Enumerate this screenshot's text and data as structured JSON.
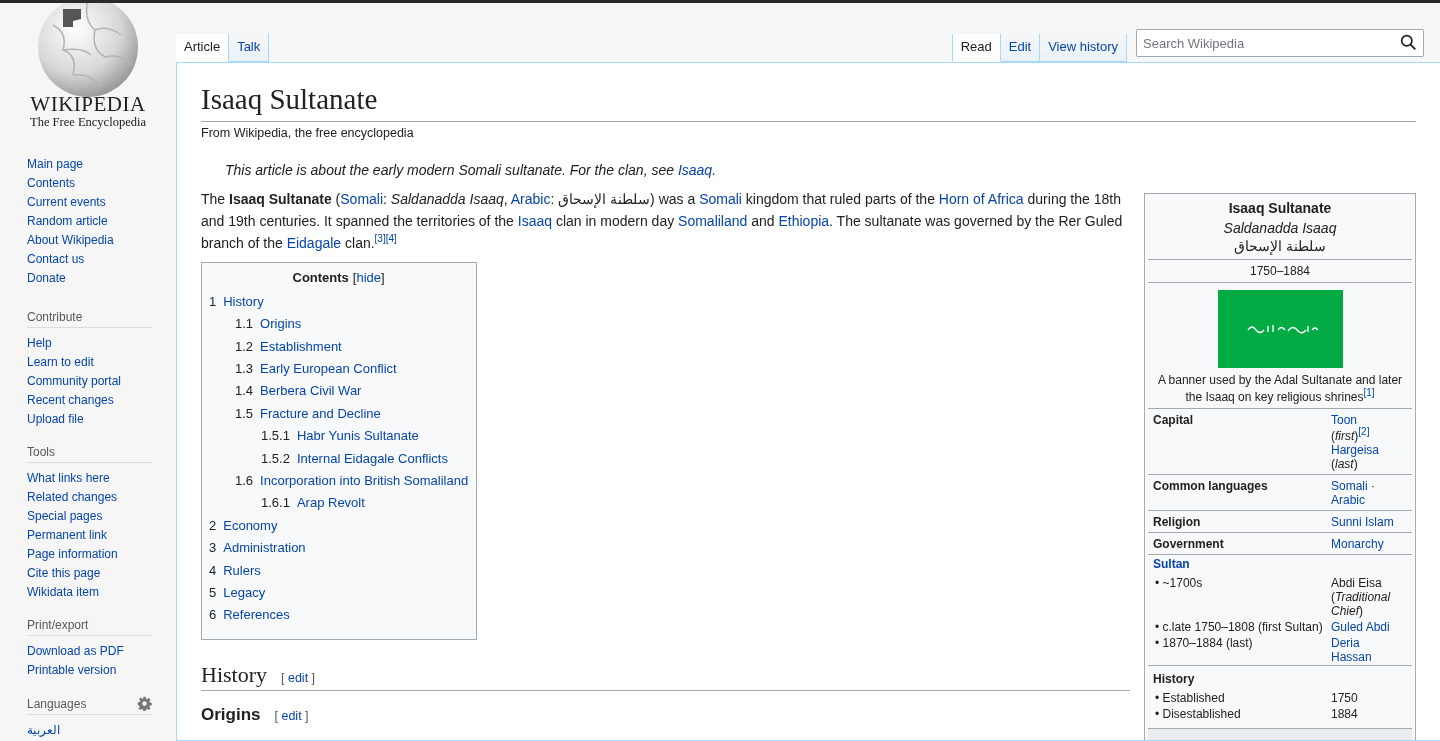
{
  "logo": {
    "wordmark": "WIKIPEDIA",
    "tagline": "The Free Encyclopedia"
  },
  "sidebar": {
    "navigation": [
      "Main page",
      "Contents",
      "Current events",
      "Random article",
      "About Wikipedia",
      "Contact us",
      "Donate"
    ],
    "sections": [
      {
        "title": "Contribute",
        "items": [
          "Help",
          "Learn to edit",
          "Community portal",
          "Recent changes",
          "Upload file"
        ]
      },
      {
        "title": "Tools",
        "items": [
          "What links here",
          "Related changes",
          "Special pages",
          "Permanent link",
          "Page information",
          "Cite this page",
          "Wikidata item"
        ]
      },
      {
        "title": "Print/export",
        "items": [
          "Download as PDF",
          "Printable version"
        ]
      },
      {
        "title": "Languages",
        "settings": true,
        "items": [
          "العربية"
        ]
      }
    ]
  },
  "namespace_tabs": [
    {
      "label": "Article",
      "selected": true
    },
    {
      "label": "Talk",
      "selected": false
    }
  ],
  "view_tabs": [
    {
      "label": "Read",
      "selected": true
    },
    {
      "label": "Edit",
      "selected": false
    },
    {
      "label": "View history",
      "selected": false
    }
  ],
  "search": {
    "placeholder": "Search Wikipedia"
  },
  "article": {
    "title": "Isaaq Sultanate",
    "tagline": "From Wikipedia, the free encyclopedia",
    "hatnote": {
      "text": "This article is about the early modern Somali sultanate. For the clan, see ",
      "link": "Isaaq",
      "end": "."
    },
    "lead": [
      {
        "kind": "text",
        "text": "The "
      },
      {
        "kind": "bold",
        "text": "Isaaq Sultanate"
      },
      {
        "kind": "text",
        "text": " ("
      },
      {
        "kind": "link",
        "text": "Somali"
      },
      {
        "kind": "text",
        "text": ": "
      },
      {
        "kind": "italic",
        "text": "Saldanadda Isaaq"
      },
      {
        "kind": "text",
        "text": ", "
      },
      {
        "kind": "link",
        "text": "Arabic"
      },
      {
        "kind": "text",
        "text": ": سلطنة الإسحاق) was a "
      },
      {
        "kind": "link",
        "text": "Somali"
      },
      {
        "kind": "text",
        "text": " kingdom that ruled parts of the "
      },
      {
        "kind": "link",
        "text": "Horn of Africa"
      },
      {
        "kind": "text",
        "text": " during the 18th and 19th centuries. It spanned the territories of the "
      },
      {
        "kind": "link",
        "text": "Isaaq"
      },
      {
        "kind": "text",
        "text": " clan in modern day "
      },
      {
        "kind": "link",
        "text": "Somaliland"
      },
      {
        "kind": "text",
        "text": " and "
      },
      {
        "kind": "link",
        "text": "Ethiopia"
      },
      {
        "kind": "text",
        "text": ". The sultanate was governed by the Rer Guled branch of the "
      },
      {
        "kind": "link",
        "text": "Eidagale"
      },
      {
        "kind": "text",
        "text": " clan."
      },
      {
        "kind": "ref",
        "text": "[3]"
      },
      {
        "kind": "ref",
        "text": "[4]"
      }
    ],
    "toc": {
      "title": "Contents",
      "toggle_open": "[",
      "toggle": "hide",
      "toggle_close": "]",
      "items": [
        {
          "number": "1",
          "text": "History",
          "children": [
            {
              "number": "1.1",
              "text": "Origins"
            },
            {
              "number": "1.2",
              "text": "Establishment"
            },
            {
              "number": "1.3",
              "text": "Early European Conflict"
            },
            {
              "number": "1.4",
              "text": "Berbera Civil War"
            },
            {
              "number": "1.5",
              "text": "Fracture and Decline",
              "children": [
                {
                  "number": "1.5.1",
                  "text": "Habr Yunis Sultanate"
                },
                {
                  "number": "1.5.2",
                  "text": "Internal Eidagale Conflicts"
                }
              ]
            },
            {
              "number": "1.6",
              "text": "Incorporation into British Somaliland",
              "children": [
                {
                  "number": "1.6.1",
                  "text": "Arap Revolt"
                }
              ]
            }
          ]
        },
        {
          "number": "2",
          "text": "Economy"
        },
        {
          "number": "3",
          "text": "Administration"
        },
        {
          "number": "4",
          "text": "Rulers"
        },
        {
          "number": "5",
          "text": "Legacy"
        },
        {
          "number": "6",
          "text": "References"
        }
      ]
    },
    "sections": [
      {
        "kind": "h2",
        "title": "History",
        "edit_open": "[",
        "edit": "edit",
        "edit_close": "]"
      },
      {
        "kind": "h3",
        "title": "Origins",
        "edit_open": "[",
        "edit": "edit",
        "edit_close": "]"
      }
    ]
  },
  "infobox": {
    "title": "Isaaq Sultanate",
    "native_name": "Saldanadda Isaaq",
    "arabic_name": "سلطنة الإسحاق",
    "dates": "1750–1884",
    "caption": [
      {
        "kind": "text",
        "text": "A banner used by the Adal Sultanate and later the Isaaq on key religious shrines"
      },
      {
        "kind": "ref",
        "text": "[1]"
      }
    ],
    "rows": [
      {
        "kind": "row",
        "label": "Capital",
        "lines": [
          [
            {
              "kind": "link",
              "text": "Toon"
            }
          ],
          [
            {
              "kind": "text",
              "text": "("
            },
            {
              "kind": "italic",
              "text": "first"
            },
            {
              "kind": "text",
              "text": ")"
            },
            {
              "kind": "ref",
              "text": "[2]"
            }
          ],
          [
            {
              "kind": "link",
              "text": "Hargeisa"
            }
          ],
          [
            {
              "kind": "text",
              "text": "("
            },
            {
              "kind": "italic",
              "text": "last"
            },
            {
              "kind": "text",
              "text": ")"
            }
          ]
        ]
      },
      {
        "kind": "row",
        "label": "Common languages",
        "lines": [
          [
            {
              "kind": "link",
              "text": "Somali"
            },
            {
              "kind": "text",
              "text": " ·"
            }
          ],
          [
            {
              "kind": "link",
              "text": "Arabic"
            }
          ]
        ]
      },
      {
        "kind": "row",
        "label": "Religion",
        "lines": [
          [
            {
              "kind": "link",
              "text": "Sunni Islam"
            }
          ]
        ]
      },
      {
        "kind": "row",
        "label": "Government",
        "lines": [
          [
            {
              "kind": "link",
              "text": "Monarchy"
            }
          ]
        ]
      },
      {
        "kind": "subheader",
        "label": "Sultan"
      },
      {
        "kind": "subrow",
        "label": "• ~1700s",
        "lines": [
          [
            {
              "kind": "text",
              "text": "Abdi Eisa"
            }
          ],
          [
            {
              "kind": "text",
              "text": "("
            },
            {
              "kind": "italic",
              "text": "Traditional"
            }
          ],
          [
            {
              "kind": "italic",
              "text": "Chief"
            },
            {
              "kind": "text",
              "text": ")"
            }
          ]
        ]
      },
      {
        "kind": "subrow",
        "label": "• c.late 1750–1808 (first Sultan)",
        "lines": [
          [
            {
              "kind": "link",
              "text": "Guled Abdi"
            }
          ]
        ]
      },
      {
        "kind": "subrow",
        "label": "• 1870–1884 (last)",
        "lines": [
          [
            {
              "kind": "link",
              "text": "Deria"
            }
          ],
          [
            {
              "kind": "link",
              "text": "Hassan"
            }
          ]
        ]
      },
      {
        "kind": "section",
        "label": "History"
      },
      {
        "kind": "subrow",
        "label": "• Established",
        "lines": [
          [
            {
              "kind": "text",
              "text": "1750"
            }
          ]
        ]
      },
      {
        "kind": "subrow",
        "label": "• Disestablished",
        "lines": [
          [
            {
              "kind": "text",
              "text": "1884"
            }
          ]
        ]
      }
    ]
  }
}
